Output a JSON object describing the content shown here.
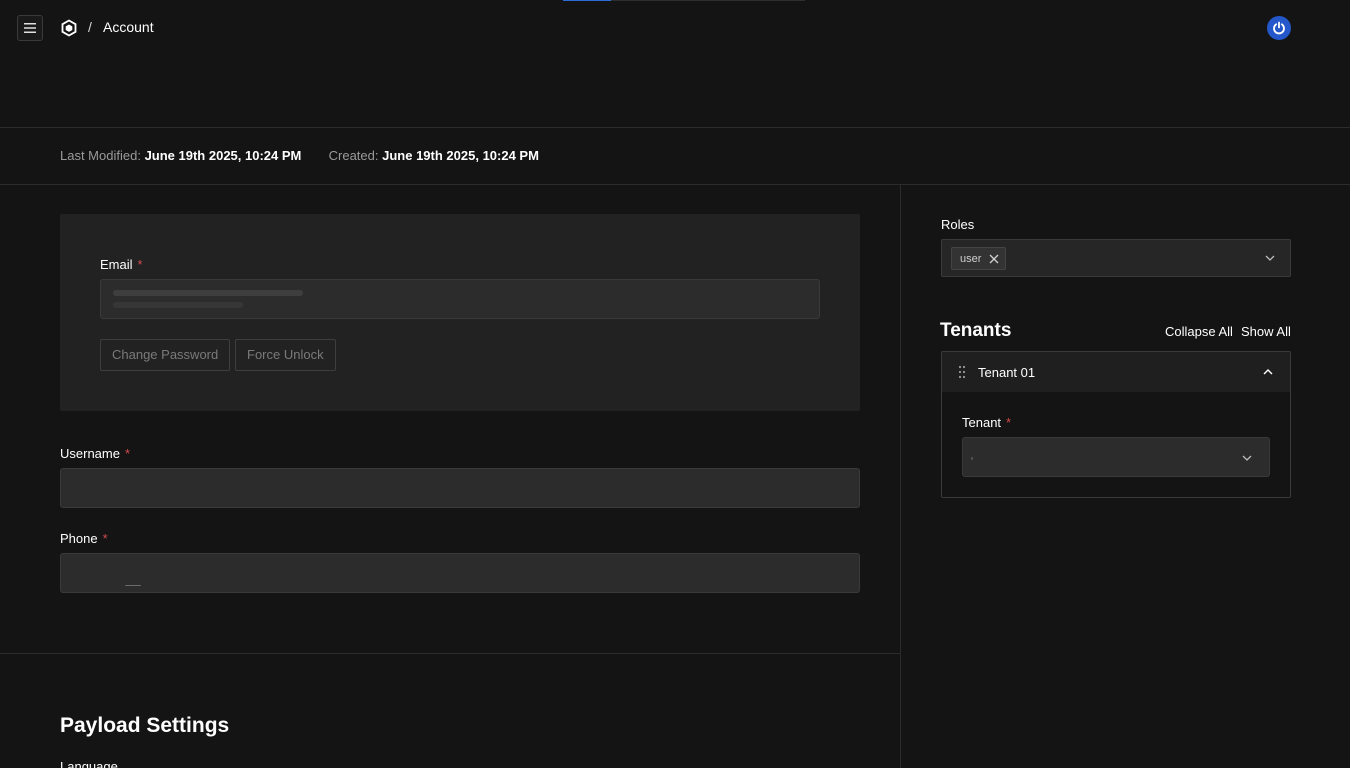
{
  "header": {
    "breadcrumb_separator": "/",
    "breadcrumb_current": "Account",
    "progress_fraction": 0.2
  },
  "meta": {
    "last_modified_label": "Last Modified:",
    "last_modified_value": "June 19th 2025, 10:24 PM",
    "created_label": "Created:",
    "created_value": "June 19th 2025, 10:24 PM"
  },
  "form": {
    "email": {
      "label": "Email",
      "required_mark": "*",
      "value": ""
    },
    "change_password_label": "Change Password",
    "force_unlock_label": "Force Unlock",
    "username": {
      "label": "Username",
      "required_mark": "*",
      "value": ""
    },
    "phone": {
      "label": "Phone",
      "required_mark": "*",
      "value": ""
    },
    "payload_settings_title": "Payload Settings",
    "language_label": "Language"
  },
  "sidebar": {
    "roles_label": "Roles",
    "roles_selected": [
      "user"
    ],
    "tenants_title": "Tenants",
    "collapse_all_label": "Collapse All",
    "show_all_label": "Show All",
    "tenant_items": [
      {
        "title": "Tenant 01",
        "field_label": "Tenant",
        "required_mark": "*",
        "value": ""
      }
    ]
  },
  "colors": {
    "background": "#141414",
    "card": "#222222",
    "input": "#2c2c2c",
    "required": "#d24b4b",
    "accent": "#2457c9"
  },
  "icons": {
    "menu": "hamburger-icon",
    "logo": "cube-logo-icon",
    "power": "power-icon",
    "chip_remove": "close-icon",
    "dropdown": "chevron-down-icon",
    "drag": "drag-handle-icon",
    "collapse": "chevron-up-icon"
  }
}
